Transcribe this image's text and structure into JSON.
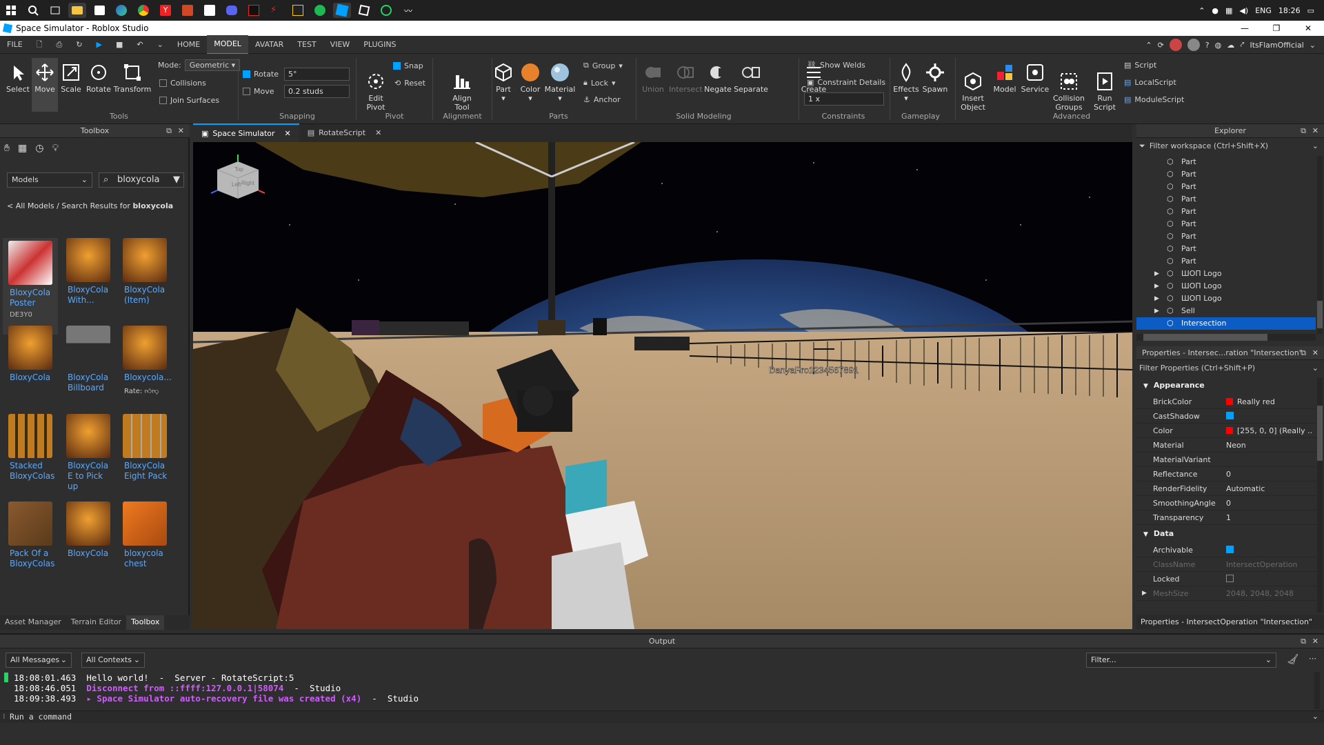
{
  "window": {
    "title": "Space Simulator - Roblox Studio"
  },
  "taskbar": {
    "lang": "ENG",
    "time": "18:26"
  },
  "menu": {
    "file": "FILE",
    "tabs": [
      "HOME",
      "MODEL",
      "AVATAR",
      "TEST",
      "VIEW",
      "PLUGINS"
    ],
    "active": "MODEL",
    "user": "ItsFlamOfficial"
  },
  "ribbon": {
    "tools": {
      "select": "Select",
      "move": "Move",
      "scale": "Scale",
      "rotate": "Rotate",
      "transform": "Transform",
      "mode_label": "Mode:",
      "mode_value": "Geometric",
      "collisions": "Collisions",
      "join_surfaces": "Join Surfaces",
      "group_label": "Tools"
    },
    "snapping": {
      "rotate": "Rotate",
      "rotate_value": "5°",
      "move": "Move",
      "move_value": "0.2 studs",
      "group_label": "Snapping"
    },
    "pivot": {
      "edit_pivot": "Edit\nPivot",
      "snap": "Snap",
      "reset": "Reset",
      "group_label": "Pivot"
    },
    "alignment": {
      "align_tool": "Align\nTool",
      "group_label": "Alignment"
    },
    "parts": {
      "part": "Part",
      "color": "Color",
      "material": "Material",
      "group": "Group",
      "lock": "Lock",
      "anchor": "Anchor",
      "group_label": "Parts"
    },
    "solid": {
      "union": "Union",
      "intersect": "Intersect",
      "negate": "Negate",
      "separate": "Separate",
      "group_label": "Solid Modeling"
    },
    "constraints": {
      "create": "Create",
      "show_welds": "Show Welds",
      "constraint_details": "Constraint Details",
      "scale_value": "1 x",
      "group_label": "Constraints"
    },
    "gameplay": {
      "effects": "Effects",
      "spawn": "Spawn",
      "group_label": "Gameplay"
    },
    "advanced": {
      "insert_object": "Insert\nObject",
      "model": "Model",
      "service": "Service",
      "collision_groups": "Collision\nGroups",
      "run_script": "Run\nScript",
      "script": "Script",
      "local_script": "LocalScript",
      "module_script": "ModuleScript",
      "group_label": "Advanced"
    }
  },
  "toolbox": {
    "title": "Toolbox",
    "category": "Models",
    "search": "bloxycola",
    "breadcrumb_prefix": "< All Models / Search Results for ",
    "breadcrumb_term": "bloxycola",
    "items": [
      {
        "name": "BloxyCola Poster",
        "creator": "DE3Y0"
      },
      {
        "name": "BloxyCola With..."
      },
      {
        "name": "BloxyCola (Item)"
      },
      {
        "name": "BloxyCola"
      },
      {
        "name": "BloxyCola Billboard"
      },
      {
        "name": "Bloxycola..."
      },
      {
        "name": "Stacked BloxyColas"
      },
      {
        "name": "BloxyCola E to Pick up"
      },
      {
        "name": "BloxyCola Eight Pack"
      },
      {
        "name": "Pack Of a BloxyColas"
      },
      {
        "name": "BloxyCola"
      },
      {
        "name": "bloxycola chest"
      }
    ],
    "rate_label": "Rate:",
    "bottom_tabs": [
      "Asset Manager",
      "Terrain Editor",
      "Toolbox"
    ]
  },
  "doc_tabs": [
    "Space Simulator",
    "RotateScript"
  ],
  "viewport": {
    "player_name": "DanyaPro1234567891",
    "cube_top": "Top",
    "cube_right": "Right",
    "cube_left": "Left"
  },
  "explorer": {
    "title": "Explorer",
    "filter_placeholder": "Filter workspace (Ctrl+Shift+X)",
    "items": [
      {
        "label": "Part",
        "expand": false
      },
      {
        "label": "Part",
        "expand": false
      },
      {
        "label": "Part",
        "expand": false
      },
      {
        "label": "Part",
        "expand": false
      },
      {
        "label": "Part",
        "expand": false
      },
      {
        "label": "Part",
        "expand": false
      },
      {
        "label": "Part",
        "expand": false
      },
      {
        "label": "Part",
        "expand": false
      },
      {
        "label": "Part",
        "expand": false
      },
      {
        "label": "ШОП Logo",
        "expand": true
      },
      {
        "label": "ШОП Logo",
        "expand": true
      },
      {
        "label": "ШОП Logo",
        "expand": true
      },
      {
        "label": "Sell",
        "expand": true
      },
      {
        "label": "Intersection",
        "expand": false,
        "selected": true
      }
    ]
  },
  "properties": {
    "title": "Properties - Intersec...ration \"Intersection\"",
    "filter_placeholder": "Filter Properties (Ctrl+Shift+P)",
    "appearance_label": "Appearance",
    "appearance": [
      {
        "name": "BrickColor",
        "value": "Really red",
        "swatch": "#ff0000"
      },
      {
        "name": "CastShadow",
        "check": true
      },
      {
        "name": "Color",
        "value": "[255, 0, 0] (Really ...",
        "swatch": "#ff0000"
      },
      {
        "name": "Material",
        "value": "Neon"
      },
      {
        "name": "MaterialVariant",
        "value": ""
      },
      {
        "name": "Reflectance",
        "value": "0"
      },
      {
        "name": "RenderFidelity",
        "value": "Automatic"
      },
      {
        "name": "SmoothingAngle",
        "value": "0"
      },
      {
        "name": "Transparency",
        "value": "1"
      }
    ],
    "data_label": "Data",
    "data": [
      {
        "name": "Archivable",
        "check": true
      },
      {
        "name": "ClassName",
        "value": "IntersectOperation",
        "dim": true
      },
      {
        "name": "Locked",
        "check": false
      },
      {
        "name": "MeshSize",
        "value": "2048, 2048, 2048",
        "dim": true
      }
    ],
    "footer": "Properties - IntersectOperation \"Intersection\""
  },
  "output": {
    "title": "Output",
    "messages_filter": "All Messages",
    "contexts_filter": "All Contexts",
    "filter_placeholder": "Filter...",
    "lines": [
      {
        "text": "18:08:01.463  Hello world!  -  Server - RotateScript:5",
        "color": "#ffffff"
      },
      {
        "time": "18:08:46.051",
        "text": "Disconnect from ::ffff:127.0.0.1|58074",
        "suffix": "  -  Studio",
        "color": "#d15bff"
      },
      {
        "time": "18:09:38.493",
        "text": "▸ Space Simulator auto-recovery file was created (x4)",
        "suffix": "  -  Studio",
        "color": "#d15bff"
      }
    ],
    "command_placeholder": "Run a command"
  },
  "colors": {
    "accent": "#00a2ff",
    "selection": "#0b5cc5",
    "link": "#5aa9ff",
    "warn": "#d15bff"
  }
}
